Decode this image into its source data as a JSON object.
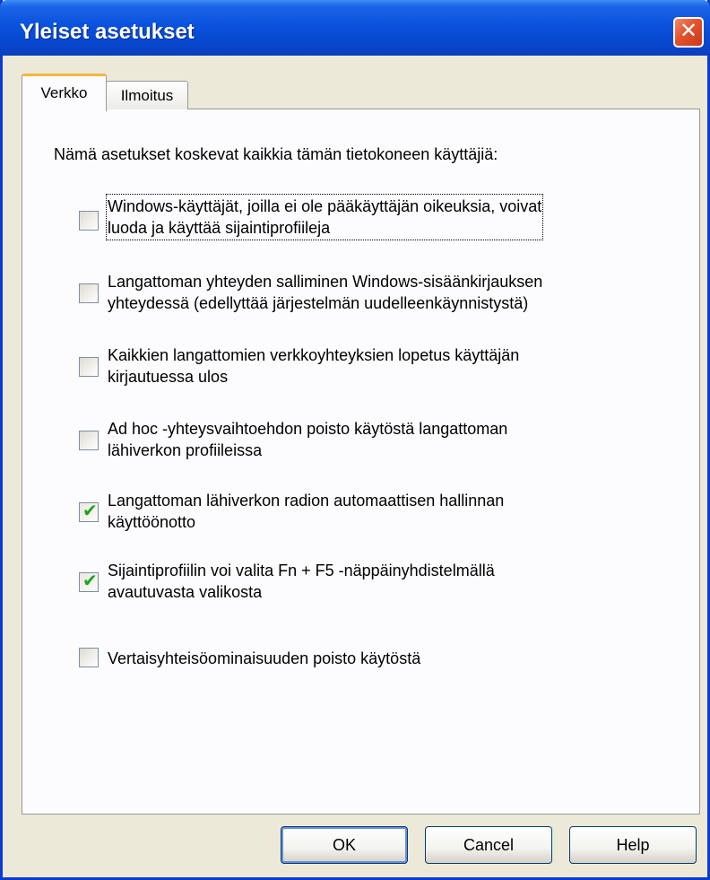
{
  "window": {
    "title": "Yleiset asetukset",
    "close_glyph": "✕"
  },
  "tabs": [
    {
      "label": "Verkko",
      "active": true
    },
    {
      "label": "Ilmoitus",
      "active": false
    }
  ],
  "panel": {
    "intro": "Nämä asetukset koskevat kaikkia tämän tietokoneen käyttäjiä:",
    "options": [
      {
        "line1": "Windows-käyttäjät, joilla ei ole pääkäyttäjän oikeuksia, voivat",
        "line2": "luoda ja käyttää sijaintiprofiileja",
        "checked": false
      },
      {
        "line1": "Langattoman yhteyden salliminen Windows-sisäänkirjauksen",
        "line2": "yhteydessä (edellyttää järjestelmän uudelleenkäynnistystä)",
        "checked": false
      },
      {
        "line1": "Kaikkien langattomien verkkoyhteyksien lopetus käyttäjän",
        "line2": "kirjautuessa ulos",
        "checked": false
      },
      {
        "line1": "Ad hoc -yhteysvaihtoehdon poisto käytöstä langattoman",
        "line2": "lähiverkon profiileissa",
        "checked": false
      },
      {
        "line1": "Langattoman lähiverkon radion automaattisen hallinnan",
        "line2": "käyttöönotto",
        "checked": true
      },
      {
        "line1": "Sijaintiprofiilin voi valita Fn + F5 -näppäinyhdistelmällä",
        "line2": "avautuvasta valikosta",
        "checked": true
      },
      {
        "line1": "Vertaisyhteisöominaisuuden poisto käytöstä",
        "line2": "",
        "checked": false
      }
    ]
  },
  "buttons": {
    "ok": "OK",
    "cancel": "Cancel",
    "help": "Help"
  },
  "colors": {
    "titlebar": "#0a52dd",
    "close_button": "#e2522b",
    "dialog_background": "#ece9d8",
    "active_tab_accent": "#f4b63c",
    "check_mark": "#21a121"
  }
}
